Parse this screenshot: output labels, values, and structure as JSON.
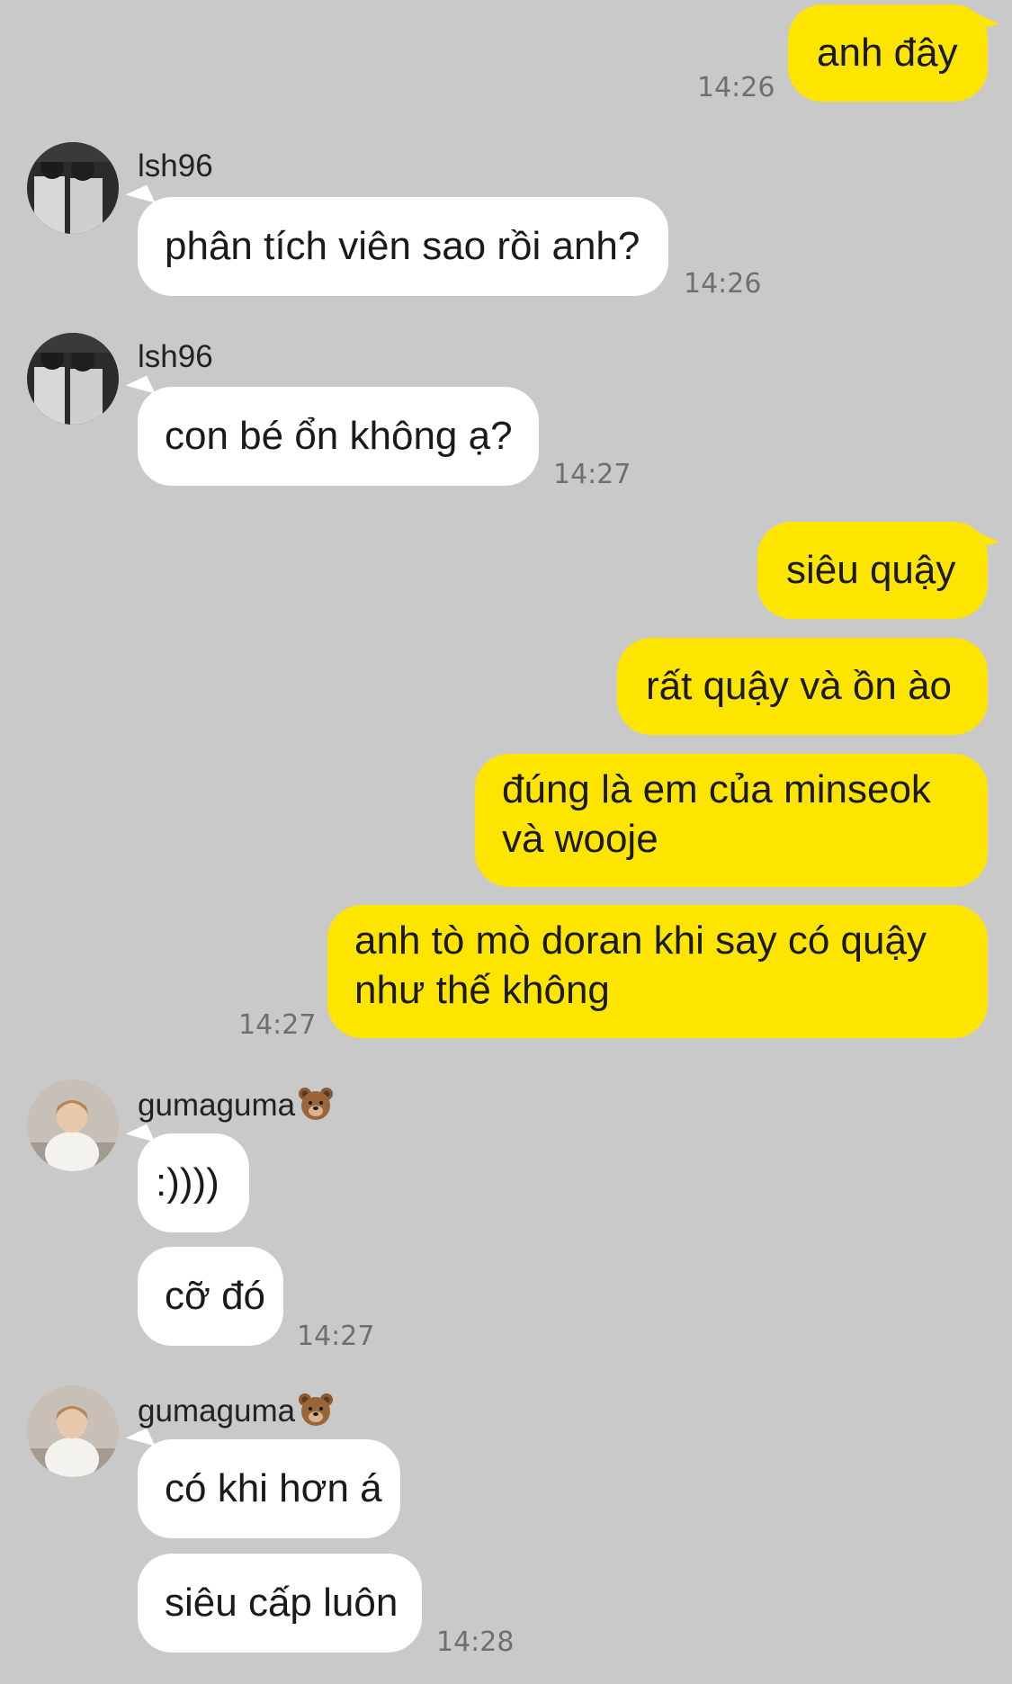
{
  "colors": {
    "background": "#c9c9c9",
    "outgoing_bubble": "#fee500",
    "incoming_bubble": "#ffffff",
    "timestamp": "#6f6f6f"
  },
  "messages": [
    {
      "id": 1,
      "direction": "outgoing",
      "text": "anh đây",
      "time": "14:26"
    },
    {
      "id": 2,
      "direction": "incoming",
      "sender": "lsh96",
      "text": "phân tích viên sao rồi anh?",
      "time": "14:26"
    },
    {
      "id": 3,
      "direction": "incoming",
      "sender": "lsh96",
      "text": "con bé ổn không ạ?",
      "time": "14:27"
    },
    {
      "id": 4,
      "direction": "outgoing",
      "text": "siêu quậy"
    },
    {
      "id": 5,
      "direction": "outgoing",
      "text": "rất quậy và ồn ào"
    },
    {
      "id": 6,
      "direction": "outgoing",
      "text_line1": "đúng là em của minseok",
      "text_line2": "và wooje"
    },
    {
      "id": 7,
      "direction": "outgoing",
      "text_line1": "anh tò mò doran khi say có quậy",
      "text_line2": "như thế không",
      "time": "14:27"
    },
    {
      "id": 8,
      "direction": "incoming",
      "sender": "gumaguma",
      "sender_emoji": "bear-face-icon",
      "text": ":))))"
    },
    {
      "id": 9,
      "direction": "incoming",
      "text": "cỡ đó",
      "time": "14:27"
    },
    {
      "id": 10,
      "direction": "incoming",
      "sender": "gumaguma",
      "sender_emoji": "bear-face-icon",
      "text": "có khi hơn á"
    },
    {
      "id": 11,
      "direction": "incoming",
      "text": "siêu cấp luôn",
      "time": "14:28"
    }
  ]
}
